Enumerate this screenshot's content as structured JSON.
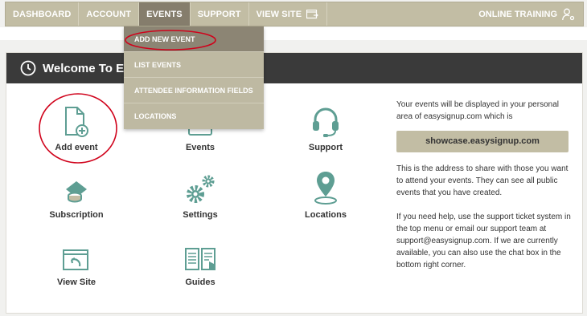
{
  "nav": {
    "items": [
      {
        "label": "DASHBOARD"
      },
      {
        "label": "ACCOUNT"
      },
      {
        "label": "EVENTS"
      },
      {
        "label": "SUPPORT"
      },
      {
        "label": "VIEW SITE"
      }
    ],
    "right_label": "ONLINE TRAINING"
  },
  "dropdown": {
    "items": [
      "ADD NEW EVENT",
      "LIST EVENTS",
      "ATTENDEE INFORMATION FIELDS",
      "LOCATIONS"
    ]
  },
  "card": {
    "title": "Welcome To Easy"
  },
  "tiles": {
    "add_event": "Add event",
    "events": "Events",
    "support": "Support",
    "subscription": "Subscription",
    "settings": "Settings",
    "locations": "Locations",
    "view_site": "View Site",
    "guides": "Guides"
  },
  "side": {
    "intro": "Your events will be displayed in your personal area of easysignup.com which is",
    "showcase": "showcase.easysignup.com",
    "share": "This is the address to share with those you want to attend your events. They can see all public events that you have created.",
    "help": "If you need help, use the support ticket system in the top menu or email our support team at support@easysignup.com. If we are currently available, you can also use the chat box in the bottom right corner."
  },
  "colors": {
    "nav_bg": "#c2bda4",
    "nav_active": "#857d6c",
    "teal": "#5e9e93",
    "header_bg": "#3a3a3a",
    "annotation_red": "#d0021b"
  }
}
